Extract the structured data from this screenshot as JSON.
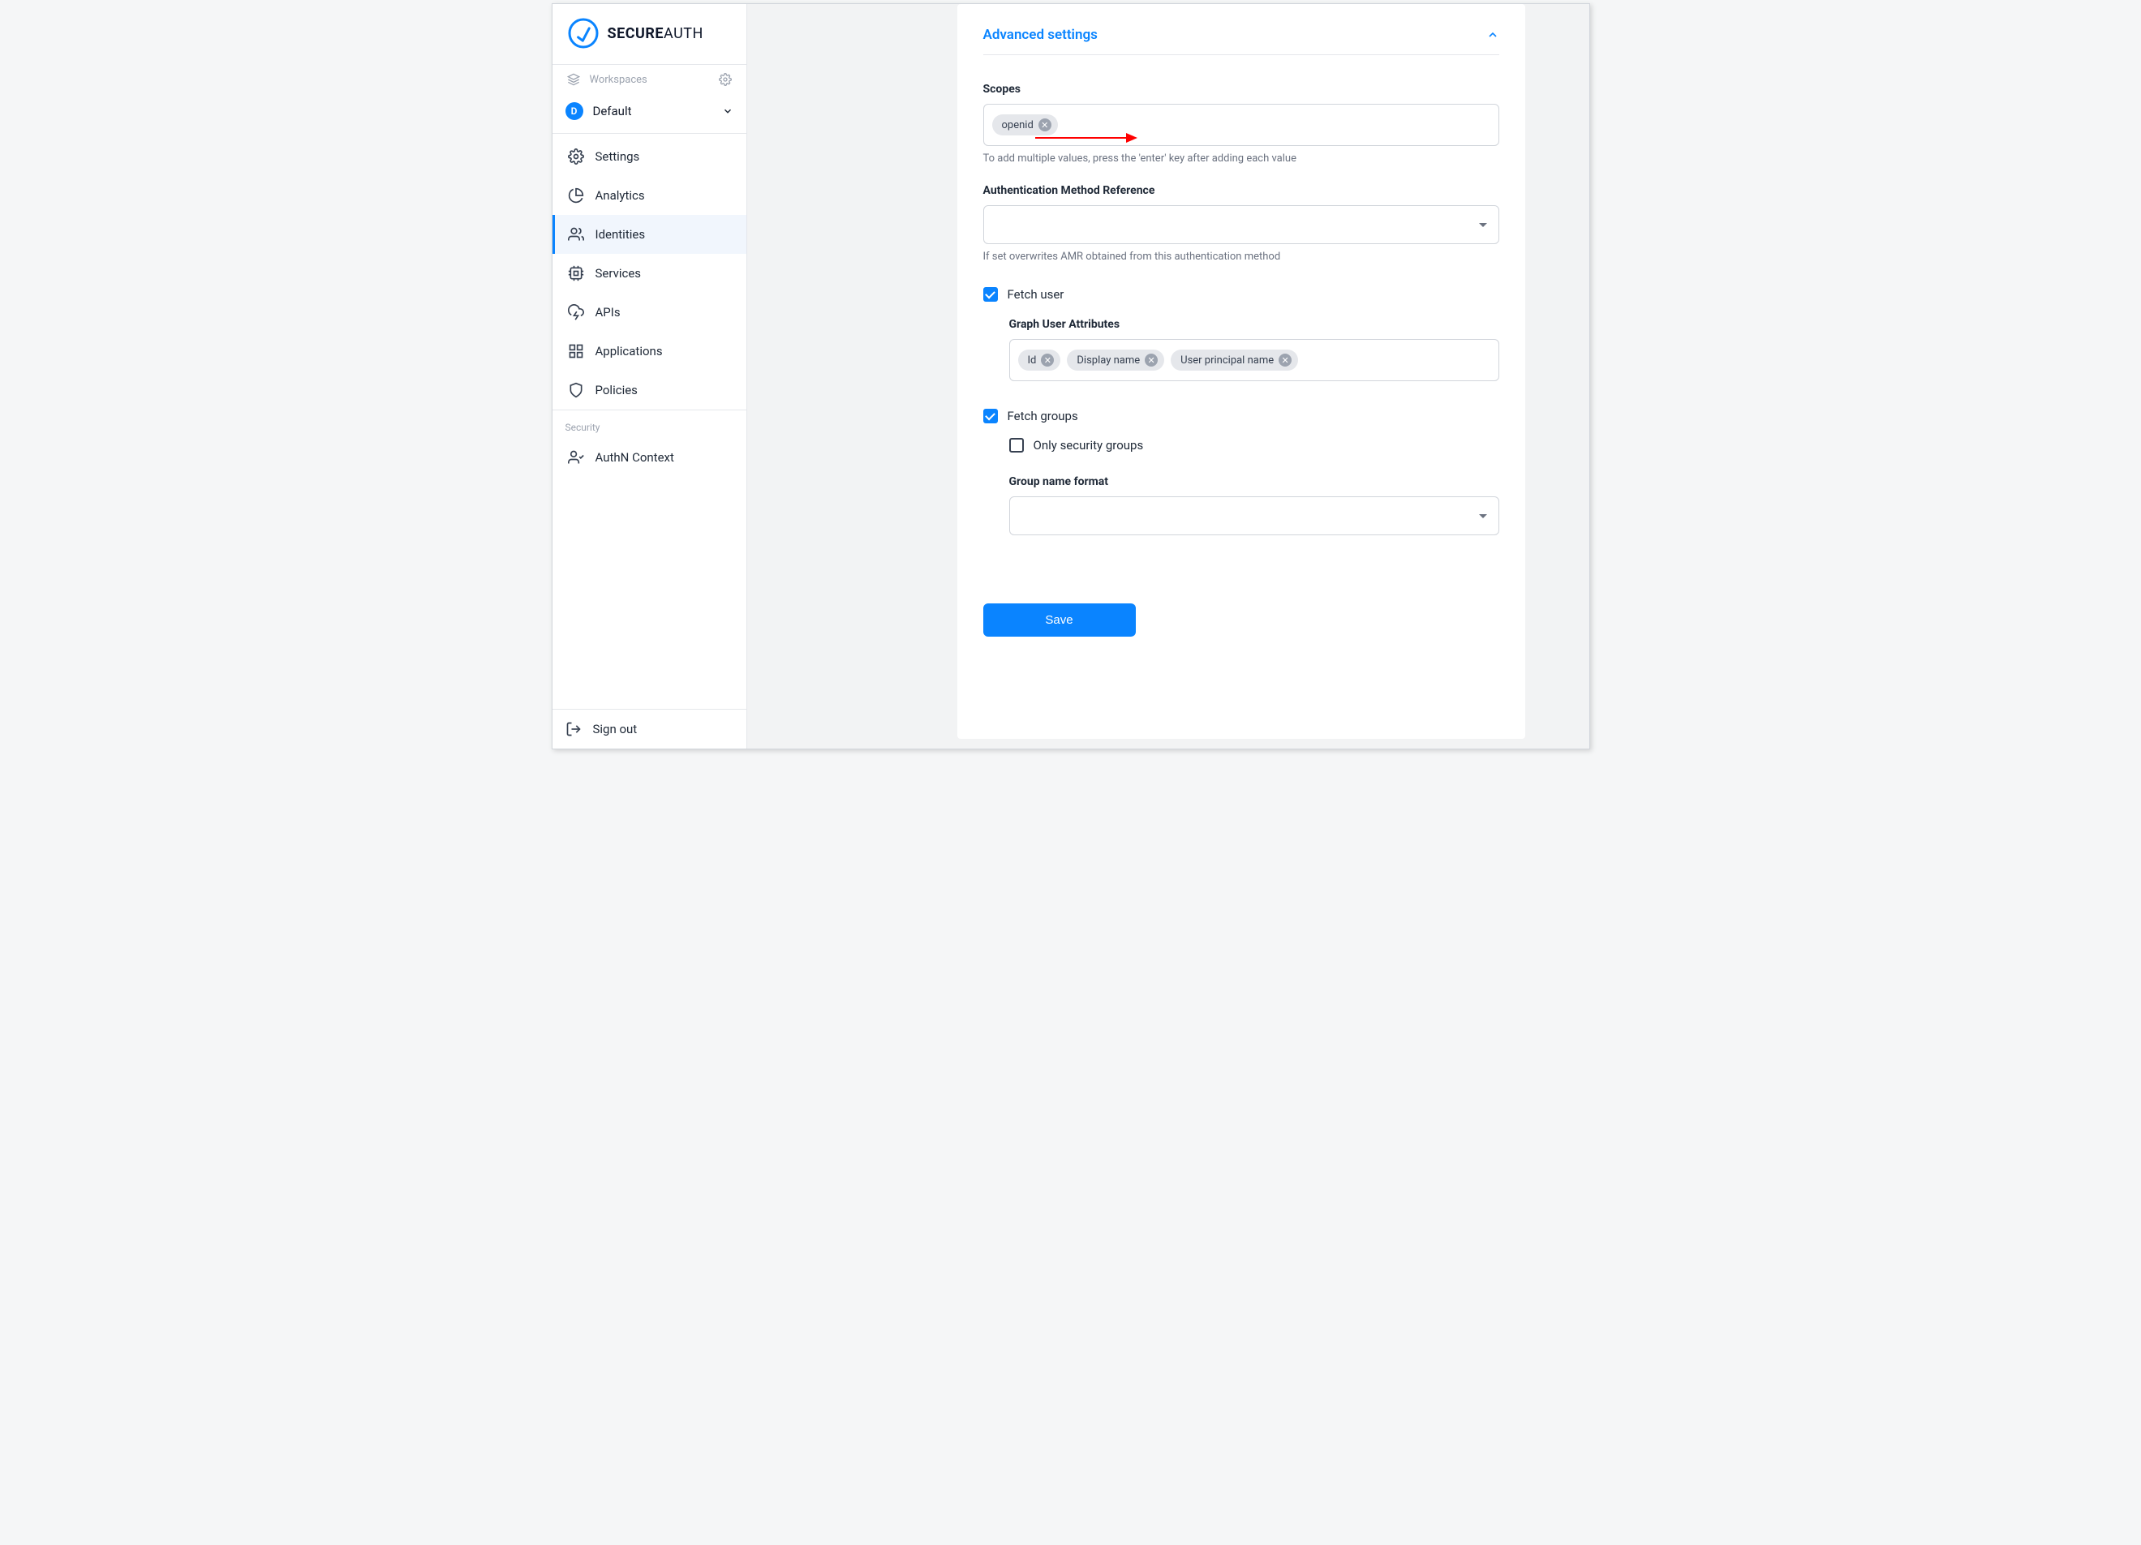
{
  "brand": {
    "name_bold": "SECURE",
    "name_thin": "AUTH"
  },
  "workspaces_label": "Workspaces",
  "workspace": {
    "badge": "D",
    "name": "Default"
  },
  "nav": {
    "settings": "Settings",
    "analytics": "Analytics",
    "identities": "Identities",
    "services": "Services",
    "apis": "APIs",
    "applications": "Applications",
    "policies": "Policies"
  },
  "security_section": "Security",
  "authn_context": "AuthN Context",
  "sign_out": "Sign out",
  "panel": {
    "title": "Advanced settings",
    "scopes": {
      "label": "Scopes",
      "chips": [
        "openid"
      ],
      "helper": "To add multiple values, press the 'enter' key after adding each value"
    },
    "amr": {
      "label": "Authentication Method Reference",
      "helper": "If set overwrites AMR obtained from this authentication method"
    },
    "fetch_user": {
      "label": "Fetch user",
      "checked": true,
      "graph_label": "Graph User Attributes",
      "graph_chips": [
        "Id",
        "Display name",
        "User principal name"
      ]
    },
    "fetch_groups": {
      "label": "Fetch groups",
      "checked": true,
      "only_security": {
        "label": "Only security groups",
        "checked": false
      },
      "group_name_format_label": "Group name format"
    },
    "save": "Save"
  }
}
